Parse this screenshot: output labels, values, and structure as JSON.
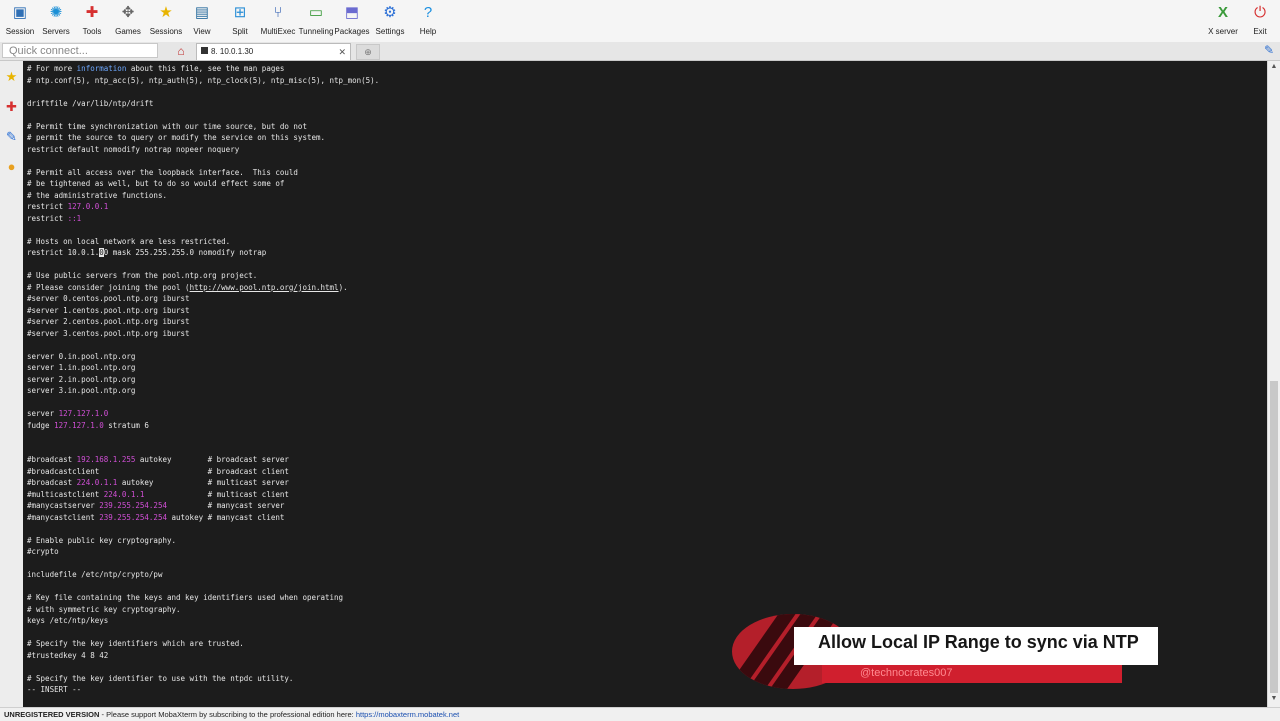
{
  "toolbar": {
    "items": [
      {
        "label": "Session",
        "icon": "session-icon",
        "color": "#2f6fb5",
        "glyph": "▣"
      },
      {
        "label": "Servers",
        "icon": "servers-icon",
        "color": "#1a8fd6",
        "glyph": "✺"
      },
      {
        "label": "Tools",
        "icon": "tools-icon",
        "color": "#d63030",
        "glyph": "✚"
      },
      {
        "label": "Games",
        "icon": "games-icon",
        "color": "#666666",
        "glyph": "✥"
      },
      {
        "label": "Sessions",
        "icon": "star-icon",
        "color": "#e8b400",
        "glyph": "★"
      },
      {
        "label": "View",
        "icon": "view-icon",
        "color": "#2a6d9e",
        "glyph": "▤"
      },
      {
        "label": "Split",
        "icon": "split-icon",
        "color": "#2a8fd6",
        "glyph": "⊞"
      },
      {
        "label": "MultiExec",
        "icon": "multiexec-icon",
        "color": "#2a5ab0",
        "glyph": "⑂"
      },
      {
        "label": "Tunneling",
        "icon": "tunneling-icon",
        "color": "#3a9a3a",
        "glyph": "▭"
      },
      {
        "label": "Packages",
        "icon": "packages-icon",
        "color": "#6b6bd0",
        "glyph": "⬒"
      },
      {
        "label": "Settings",
        "icon": "settings-icon",
        "color": "#2a6fd6",
        "glyph": "⚙"
      },
      {
        "label": "Help",
        "icon": "help-icon",
        "color": "#1a8fe0",
        "glyph": "?"
      }
    ],
    "xserver": {
      "label": "X server",
      "icon": "x-server-icon",
      "glyph": "X"
    },
    "exit": {
      "label": "Exit",
      "icon": "power-icon",
      "glyph": "⏻"
    }
  },
  "tabbar": {
    "quick_connect_placeholder": "Quick connect...",
    "tab_label": "8. 10.0.1.30"
  },
  "terminal": {
    "lines": [
      [
        {
          "t": "# For more "
        },
        {
          "t": "information",
          "c": "kw"
        },
        {
          "t": " about this file, see the man pages"
        }
      ],
      [
        {
          "t": "# ntp.conf(5), ntp_acc(5), ntp_auth(5), ntp_clock(5), ntp_misc(5), ntp_mon(5)."
        }
      ],
      [],
      [
        {
          "t": "driftfile /var/lib/ntp/drift"
        }
      ],
      [],
      [
        {
          "t": "# Permit time synchronization with our time source, but do not"
        }
      ],
      [
        {
          "t": "# permit the source to query or modify the service on this system."
        }
      ],
      [
        {
          "t": "restrict default nomodify notrap nopeer noquery"
        }
      ],
      [],
      [
        {
          "t": "# Permit all access over the loopback interface.  This could"
        }
      ],
      [
        {
          "t": "# be tightened as well, but to do so would effect some of"
        }
      ],
      [
        {
          "t": "# the administrative functions."
        }
      ],
      [
        {
          "t": "restrict "
        },
        {
          "t": "127.0.0.1",
          "c": "ip"
        }
      ],
      [
        {
          "t": "restrict "
        },
        {
          "t": "::1",
          "c": "ip"
        }
      ],
      [],
      [
        {
          "t": "# Hosts on local network are less restricted."
        }
      ],
      [
        {
          "t": "restrict 10.0.1."
        },
        {
          "t": "0",
          "c": "cursor"
        },
        {
          "t": "0 mask 255.255.255.0 nomodify notrap"
        }
      ],
      [],
      [
        {
          "t": "# Use public servers from the pool.ntp.org project."
        }
      ],
      [
        {
          "t": "# Please consider joining the pool ("
        },
        {
          "t": "http://www.pool.ntp.org/join.html",
          "c": "url"
        },
        {
          "t": ")."
        }
      ],
      [
        {
          "t": "#server 0.centos.pool.ntp.org iburst"
        }
      ],
      [
        {
          "t": "#server 1.centos.pool.ntp.org iburst"
        }
      ],
      [
        {
          "t": "#server 2.centos.pool.ntp.org iburst"
        }
      ],
      [
        {
          "t": "#server 3.centos.pool.ntp.org iburst"
        }
      ],
      [],
      [
        {
          "t": "server 0.in.pool.ntp.org"
        }
      ],
      [
        {
          "t": "server 1.in.pool.ntp.org"
        }
      ],
      [
        {
          "t": "server 2.in.pool.ntp.org"
        }
      ],
      [
        {
          "t": "server 3.in.pool.ntp.org"
        }
      ],
      [],
      [
        {
          "t": "server "
        },
        {
          "t": "127.127.1.0",
          "c": "ip"
        }
      ],
      [
        {
          "t": "fudge "
        },
        {
          "t": "127.127.1.0",
          "c": "ip"
        },
        {
          "t": " stratum 6"
        }
      ],
      [],
      [],
      [
        {
          "t": "#broadcast "
        },
        {
          "t": "192.168.1.255",
          "c": "ip"
        },
        {
          "t": " autokey        # broadcast server"
        }
      ],
      [
        {
          "t": "#broadcastclient                        # broadcast client"
        }
      ],
      [
        {
          "t": "#broadcast "
        },
        {
          "t": "224.0.1.1",
          "c": "ip"
        },
        {
          "t": " autokey            # multicast server"
        }
      ],
      [
        {
          "t": "#multicastclient "
        },
        {
          "t": "224.0.1.1",
          "c": "ip"
        },
        {
          "t": "              # multicast client"
        }
      ],
      [
        {
          "t": "#manycastserver "
        },
        {
          "t": "239.255.254.254",
          "c": "ip"
        },
        {
          "t": "         # manycast server"
        }
      ],
      [
        {
          "t": "#manycastclient "
        },
        {
          "t": "239.255.254.254",
          "c": "ip"
        },
        {
          "t": " autokey # manycast client"
        }
      ],
      [],
      [
        {
          "t": "# Enable public key cryptography."
        }
      ],
      [
        {
          "t": "#crypto"
        }
      ],
      [],
      [
        {
          "t": "includefile /etc/ntp/crypto/pw"
        }
      ],
      [],
      [
        {
          "t": "# Key file containing the keys and key identifiers used when operating"
        }
      ],
      [
        {
          "t": "# with symmetric key cryptography."
        }
      ],
      [
        {
          "t": "keys /etc/ntp/keys"
        }
      ],
      [],
      [
        {
          "t": "# Specify the key identifiers which are trusted."
        }
      ],
      [
        {
          "t": "#trustedkey 4 8 42"
        }
      ],
      [],
      [
        {
          "t": "# Specify the key identifier to use with the ntpdc utility."
        }
      ],
      [
        {
          "t": "-- INSERT --"
        }
      ]
    ]
  },
  "status": {
    "bold": "UNREGISTERED VERSION",
    "text": "  -  Please support MobaXterm by subscribing to the professional edition here: ",
    "link": "https://mobaxterm.mobatek.net"
  },
  "overlay": {
    "title": "Allow Local IP Range to sync via NTP",
    "handle": "@technocrates007"
  },
  "colors": {
    "ip": "#d14fd6",
    "keyword": "#6ea8ff",
    "terminal_bg": "#1c1c1c",
    "brand_red": "#d01f2e"
  }
}
